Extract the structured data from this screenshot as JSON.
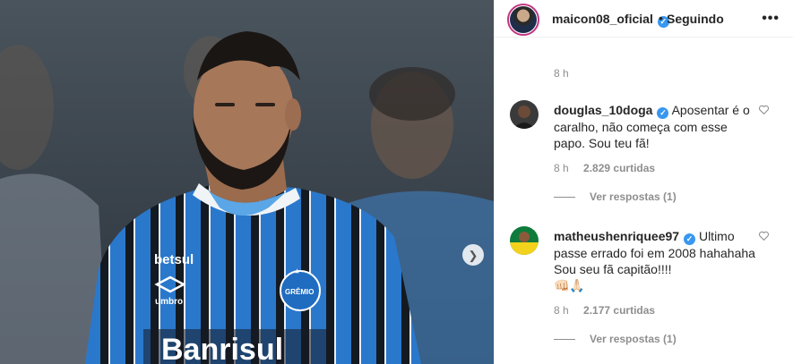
{
  "header": {
    "username": "maicon08_oficial",
    "separator": "•",
    "follow_label": "Seguindo",
    "more_icon": "•••"
  },
  "top_comment": {
    "time": "8 h"
  },
  "comments": [
    {
      "username": "douglas_10doga",
      "text": "Aposentar é o caralho, não começa com esse papo. Sou teu fã!",
      "time": "8 h",
      "likes": "2.829 curtidas",
      "view_replies": "Ver respostas (1)"
    },
    {
      "username": "matheushenriquee97",
      "text": "Ultimo passe errado foi em 2008 hahahaha Sou seu fã capitão!!!!",
      "emoji": "👊🏻🙏🏻",
      "time": "8 h",
      "likes": "2.177 curtidas",
      "view_replies": "Ver respostas (1)"
    }
  ],
  "photo": {
    "jersey_sponsor": "Banrisul",
    "jersey_brand": "betsul",
    "kit_maker": "umbro",
    "crest_text": "GRÊMIO"
  },
  "colors": {
    "verified": "#3897f0",
    "secondary_text": "#8e8e8e",
    "jersey_blue": "#2f7fd0",
    "jersey_black": "#121820"
  },
  "icons": {
    "verified": "verified-badge-icon",
    "heart": "heart-outline-icon",
    "carousel_next": "chevron-right-icon"
  }
}
